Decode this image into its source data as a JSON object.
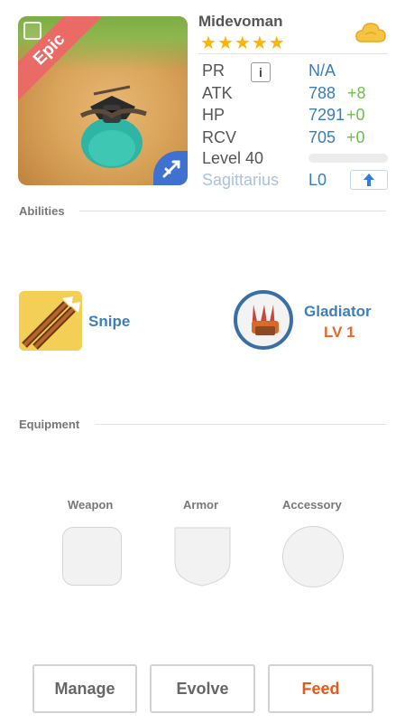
{
  "character": {
    "name": "Midevoman",
    "stars": 5,
    "star_glyph": "★★★★★",
    "rarity": "Epic"
  },
  "stats": {
    "pr": {
      "label": "PR",
      "value": "N/A"
    },
    "atk": {
      "label": "ATK",
      "value": "788",
      "bonus": "+8"
    },
    "hp": {
      "label": "HP",
      "value": "7291",
      "bonus": "+0"
    },
    "rcv": {
      "label": "RCV",
      "value": "705",
      "bonus": "+0"
    },
    "level": {
      "label": "Level 40"
    },
    "constellation": {
      "label": "Sagittarius",
      "value": "L0"
    }
  },
  "abilities": {
    "title": "Abilities",
    "skill": {
      "name": "Snipe"
    },
    "leader": {
      "name": "Gladiator",
      "level": "LV 1"
    }
  },
  "equipment": {
    "title": "Equipment",
    "slots": [
      {
        "label": "Weapon"
      },
      {
        "label": "Armor"
      },
      {
        "label": "Accessory"
      }
    ]
  },
  "actions": {
    "manage": "Manage",
    "evolve": "Evolve",
    "feed": "Feed"
  },
  "colors": {
    "accent_blue": "#3a7cbf",
    "bonus_green": "#6cc04a",
    "feed_orange": "#e25a1c",
    "epic_red": "#ea6a66"
  }
}
